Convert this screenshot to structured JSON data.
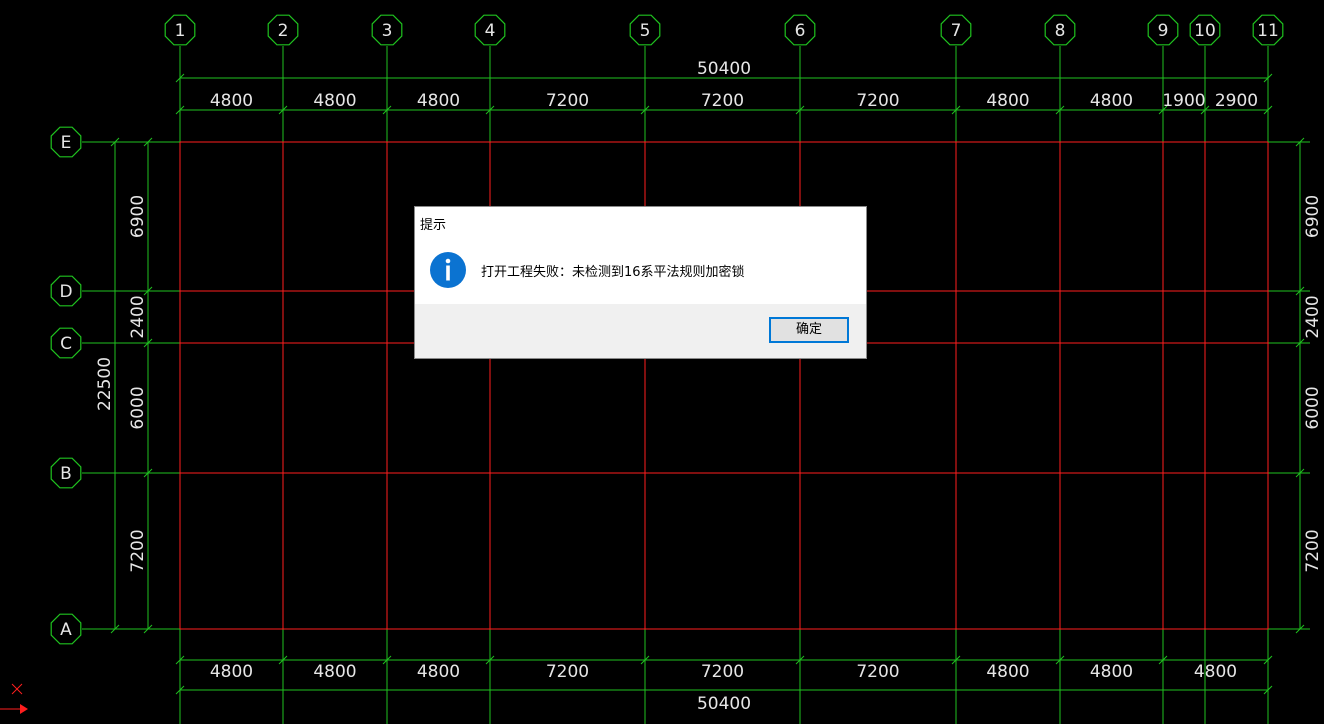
{
  "drawing": {
    "colors": {
      "background": "#000000",
      "grid_line": "#ff1e1e",
      "dimension_line": "#1fc21f",
      "axis_bubble": "#1fc21f",
      "text": "#e6e6e6"
    },
    "column_axes": [
      "1",
      "2",
      "3",
      "4",
      "5",
      "6",
      "7",
      "8",
      "9",
      "10",
      "11"
    ],
    "row_axes": [
      "A",
      "B",
      "C",
      "D",
      "E"
    ],
    "top_total": "50400",
    "top_spans": [
      "4800",
      "4800",
      "4800",
      "7200",
      "7200",
      "7200",
      "4800",
      "4800",
      "1900",
      "2900"
    ],
    "bottom_spans": [
      "4800",
      "4800",
      "4800",
      "7200",
      "7200",
      "7200",
      "4800",
      "4800",
      "4800"
    ],
    "bottom_total": "50400",
    "left_spans": [
      "6900",
      "2400",
      "6000",
      "7200"
    ],
    "left_total": "22500",
    "right_spans": [
      "6900",
      "2400",
      "6000",
      "7200"
    ],
    "ucs_icon": "ucs-axis-icon"
  },
  "dialog": {
    "title": "提示",
    "icon": "info-icon",
    "message": "打开工程失败：未检测到16系平法规则加密锁",
    "ok_label": "确定",
    "accent_color": "#0078d7"
  }
}
